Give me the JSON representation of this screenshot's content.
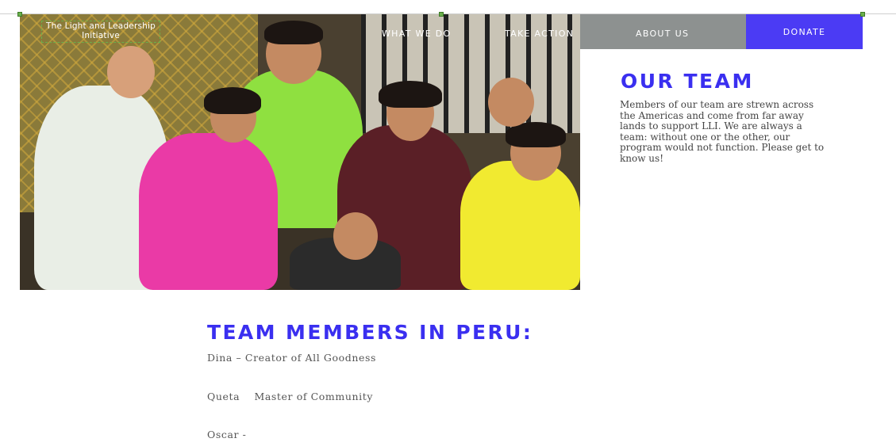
{
  "header": {
    "logo_text": "The Light and Leadership Initiative",
    "nav": [
      "WHAT WE DO",
      "TAKE ACTION",
      "ABOUT US"
    ],
    "donate_label": "DONATE"
  },
  "colors": {
    "accent": "#3a2ff0",
    "donate_bg": "#4b3bf4",
    "nav_grey": "#8d9190"
  },
  "hero": {
    "image_name": "team-photo"
  },
  "our_team": {
    "title": "OUR TEAM",
    "body": "Members of our team are strewn across the Americas and come from far away lands to support LLI. We are always a team: without one or the other, our program would not function. Please get to know us!"
  },
  "members": {
    "title": "TEAM MEMBERS IN PERU:",
    "items": [
      "Dina – Creator of All Goodness",
      "Queta    Master of Community",
      "Oscar -"
    ]
  }
}
